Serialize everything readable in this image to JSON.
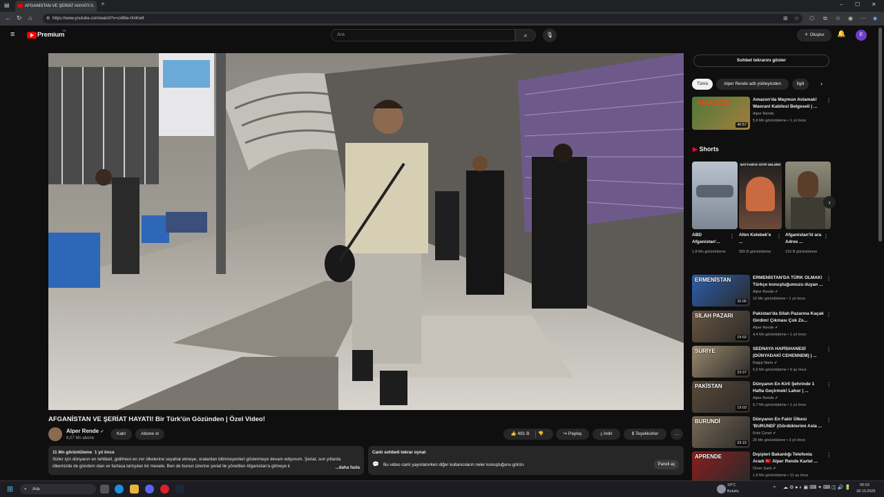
{
  "browser": {
    "tab_title": "AFGANİSTAN VE ŞERİAT HAYATI! ...",
    "url": "https://www.youtube.com/watch?v=cxB6e-0mKw8"
  },
  "header": {
    "logo_text": "Premium",
    "logo_sup": "TR",
    "search_placeholder": "Ara",
    "create_label": "Oluştur",
    "avatar_letter": "E"
  },
  "video": {
    "title": "AFGANİSTAN VE ŞERİAT HAYATI! Bir Türk'ün Gözünden | Özel Video!",
    "channel": "Alper Rende",
    "subscribers": "6,07 Mn abone",
    "join_label": "Katıl",
    "subscribe_label": "Abone ol",
    "likes": "491 B",
    "share_label": "Paylaş",
    "download_label": "İndir",
    "thanks_label": "Teşekkürler",
    "more": "…"
  },
  "description": {
    "views": "11 Mn görüntüleme",
    "date": "1 yıl önce",
    "text": "Sizler için dünyanın en tehlikeli, gidilmesi en zor ülkelerine seyahat etmeye, oralardan bilinmeyenleri göstermeye devam ediyorum. Şeriat, son yıllarda ülkemizde de gündem olan ve fazlaca tartışılan bir mesele. Ben de bunun üzerine şeriat ile yönetilen Afganistan'a gitmeye k",
    "more_label": "...daha fazla"
  },
  "chat_replay": {
    "title": "Canlı sohbeti tekrar oynat",
    "text": "Bu video canlı yayınlanırken diğer kullanıcıların neler konuştuğunu görün.",
    "button": "Paneli aç"
  },
  "sidebar": {
    "show_chat": "Sohbet tekrarını göster",
    "chips": [
      "Tümü",
      "Alper Rende adlı yükleyiciden",
      "İlgili"
    ],
    "first": {
      "title": "Amazon'da Maymun Avlamak! Waorani Kabilesi Belgeseli | ...",
      "channel": "Alper Rende",
      "meta": "5,6 Mn görüntüleme • 1 yıl önce",
      "duration": "40:57"
    },
    "shorts_label": "Shorts",
    "shorts": [
      {
        "title": "ABD Afganistan'...",
        "views": "1,8 Mn görüntüleme"
      },
      {
        "title": "Altın Kelebek'e ...",
        "views": "555 B görüntüleme",
        "overlay": "BATTANİYE GİYİP GELDİNİ"
      },
      {
        "title": "Afganistan'lıl ara Adres ...",
        "views": "216 B görüntüleme"
      }
    ],
    "videos": [
      {
        "title": "ERMENİSTAN'DA TÜRK OLMAK! Türkçe konuştuğumuzu duyan ...",
        "channel": "Alper Rende",
        "meta": "10 Mn görüntüleme • 1 yıl önce",
        "duration": "25:05",
        "thumb_text": "ERMENİSTAN",
        "thumb_color": "#2b5fae"
      },
      {
        "title": "Pakistan'da Silah Pazarına Kaçak Girdim! Çıkması Çok Zo...",
        "channel": "Alper Rende",
        "meta": "4,4 Mn görüntüleme • 1 yıl önce",
        "duration": "19:02",
        "thumb_text": "SİLAH PAZARI",
        "thumb_color": "#6b5640"
      },
      {
        "title": "SEDNAYA HAPİSHANESİ (DÜNYADAKİ CEHENNEM) | ...",
        "channel": "Ragıp Narin",
        "meta": "5,6 Mn görüntüleme • 9 ay önce",
        "duration": "23:37",
        "thumb_text": "SURİYE",
        "thumb_color": "#9c8a6c"
      },
      {
        "title": "Dünyanın En Kirli Şehrinde 1 Hafta Geçirmek! Lahor | ...",
        "channel": "Alper Rende",
        "meta": "5,7 Mn görüntüleme • 1 yıl önce",
        "duration": "19:03",
        "thumb_text": "PAKİSTAN",
        "thumb_color": "#5a4a36"
      },
      {
        "title": "Dünyanın En Fakir Ülkesi 'BURUNDİ' (Gördüklerimi Asla ...",
        "channel": "Ruhi Çenet",
        "meta": "25 Mn görüntüleme • 3 yıl önce",
        "duration": "33:15",
        "thumb_text": "BURUNDİ",
        "thumb_color": "#7a6a55"
      },
      {
        "title": "Dışişleri Bakanlığı Telefonla Aradı 🇹🇷 Alper Rende Kartel ...",
        "channel": "Ömer Şanlı",
        "meta": "1,6 Mn görüntüleme • 11 ay önce",
        "duration": "",
        "thumb_text": "APRENDE",
        "thumb_color": "#8b1d1d"
      }
    ]
  },
  "taskbar": {
    "search": "Ara",
    "weather_temp": "19°C",
    "weather_desc": "Bulutlu",
    "time": "00:03",
    "date": "28.10.2025"
  },
  "colors": {
    "accent_red": "#ff0000",
    "bg": "#0f0f0f",
    "chip_active": "#f1f1f1"
  }
}
